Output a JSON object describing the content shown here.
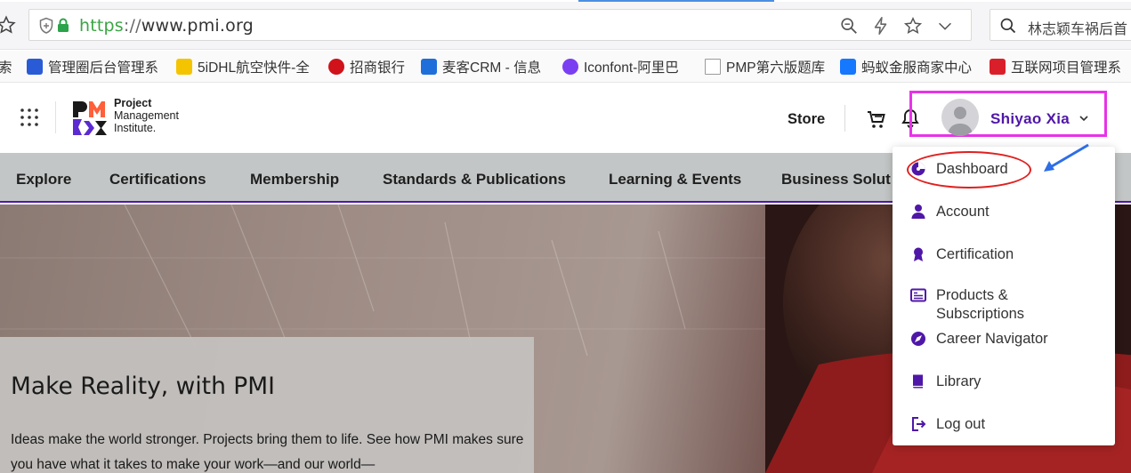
{
  "browser": {
    "url_scheme": "https",
    "url_separator": "://",
    "url_host": "www.pmi.org",
    "search_text": "林志颖车祸后首",
    "bookmarks": [
      {
        "label": "索",
        "color": "#ffffff"
      },
      {
        "label": "管理圈后台管理系",
        "color": "#2a5bd7"
      },
      {
        "label": "5iDHL航空快件-全",
        "color": "#f5c400"
      },
      {
        "label": "招商银行",
        "color": "#d0121b"
      },
      {
        "label": "麦客CRM - 信息",
        "color": "#1e6fd9"
      },
      {
        "label": "Iconfont-阿里巴",
        "color": "#7b3ff2"
      },
      {
        "label": "PMP第六版题库",
        "color": "#9a9a9a"
      },
      {
        "label": "蚂蚁金服商家中心",
        "color": "#1677ff"
      },
      {
        "label": "互联网项目管理系",
        "color": "#d9202a"
      }
    ]
  },
  "header": {
    "logo_line1": "Project",
    "logo_line2": "Management",
    "logo_line3": "Institute.",
    "store_label": "Store",
    "user_name": "Shiyao Xia"
  },
  "nav": {
    "items": [
      {
        "label": "Explore"
      },
      {
        "label": "Certifications"
      },
      {
        "label": "Membership"
      },
      {
        "label": "Standards & Publications"
      },
      {
        "label": "Learning & Events"
      },
      {
        "label": "Business Solut"
      }
    ]
  },
  "hero": {
    "title": "Make Reality, with PMI",
    "text": "Ideas make the world stronger. Projects bring them to life. See how PMI makes sure you have what it takes to make your work—and our world—"
  },
  "menu": {
    "items": [
      {
        "label": "Dashboard",
        "icon": "dashboard-icon"
      },
      {
        "label": "Account",
        "icon": "account-icon"
      },
      {
        "label": "Certification",
        "icon": "certification-icon"
      },
      {
        "label": "Products & Subscriptions",
        "icon": "products-icon"
      },
      {
        "label": "Career Navigator",
        "icon": "career-navigator-icon"
      },
      {
        "label": "Library",
        "icon": "library-icon"
      },
      {
        "label": "Log out",
        "icon": "logout-icon"
      }
    ]
  },
  "colors": {
    "brand_purple": "#4f17a8",
    "annotation_magenta": "#e832e8",
    "annotation_red": "#e02020",
    "annotation_blue": "#2e6ee6"
  }
}
